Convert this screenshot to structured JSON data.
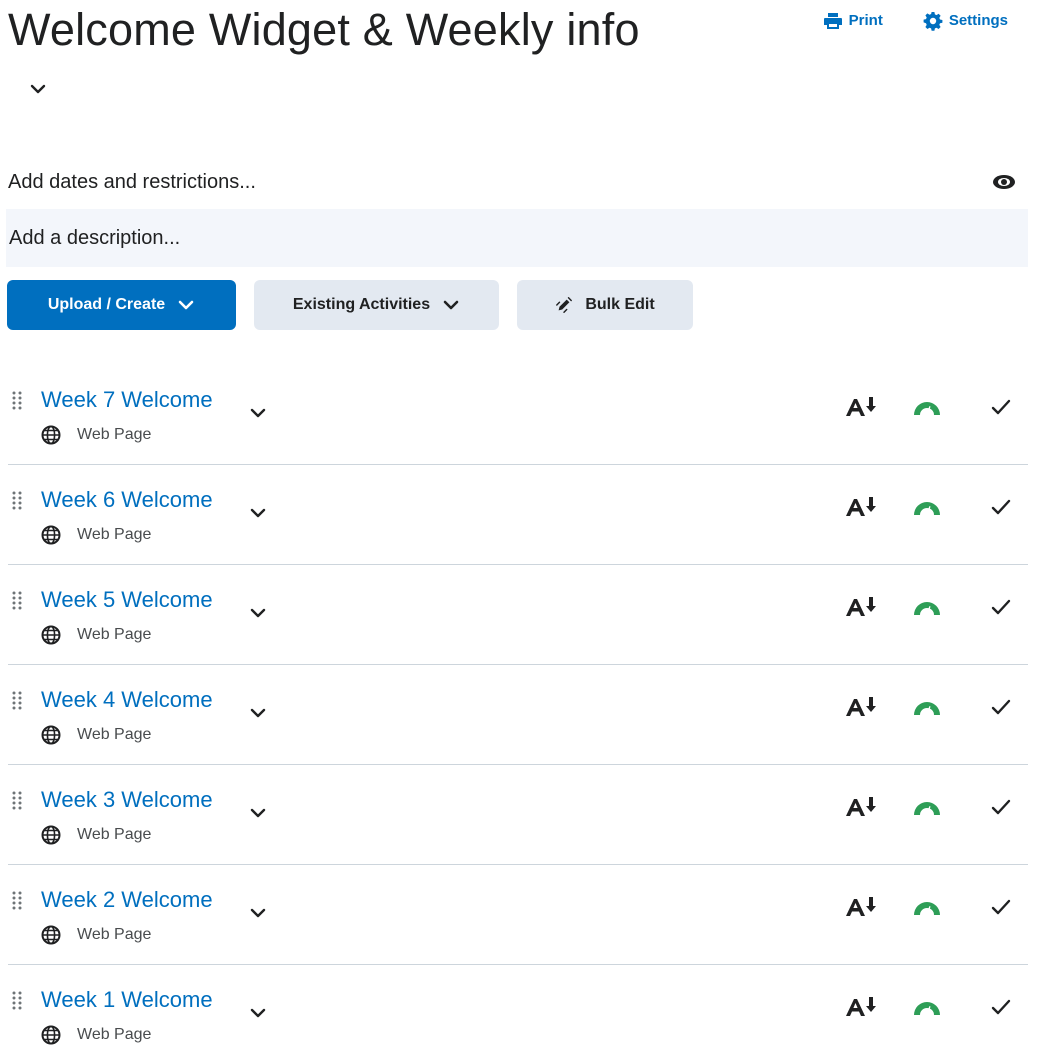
{
  "header": {
    "title": "Welcome Widget & Weekly info",
    "print_label": "Print",
    "settings_label": "Settings"
  },
  "dates_restrictions": "Add dates and restrictions...",
  "description_placeholder": "Add a description...",
  "buttons": {
    "upload_create": "Upload / Create",
    "existing_activities": "Existing Activities",
    "bulk_edit": "Bulk Edit"
  },
  "items": [
    {
      "title": "Week 7 Welcome",
      "type": "Web Page"
    },
    {
      "title": "Week 6 Welcome",
      "type": "Web Page"
    },
    {
      "title": "Week 5 Welcome",
      "type": "Web Page"
    },
    {
      "title": "Week 4 Welcome",
      "type": "Web Page"
    },
    {
      "title": "Week 3 Welcome",
      "type": "Web Page"
    },
    {
      "title": "Week 2 Welcome",
      "type": "Web Page"
    },
    {
      "title": "Week 1 Welcome",
      "type": "Web Page"
    }
  ],
  "colors": {
    "accent": "#006fbf",
    "speed_icon": "#2e9e57"
  },
  "icons": {
    "item_status": [
      "a-sort-down-icon",
      "speedometer-icon",
      "checkmark-icon"
    ]
  }
}
